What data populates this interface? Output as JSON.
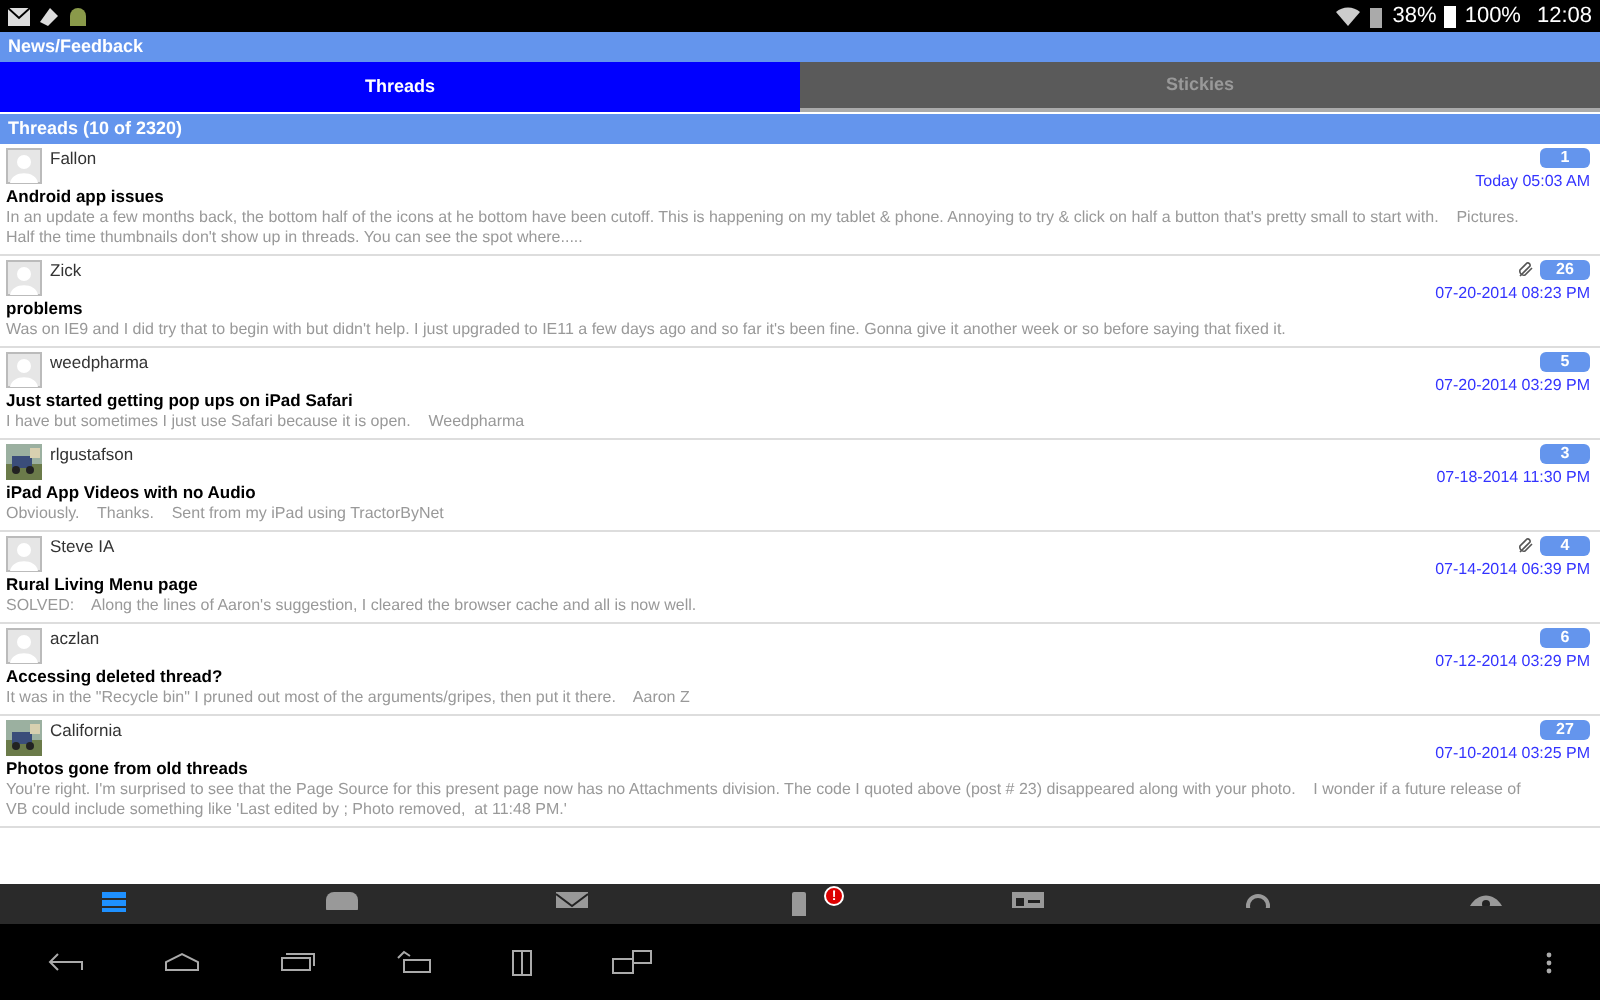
{
  "status_bar": {
    "signal_text": "38%",
    "battery": "100%",
    "time": "12:08"
  },
  "title": "News/Feedback",
  "tabs": [
    {
      "label": "Threads",
      "selected": true
    },
    {
      "label": "Stickies",
      "selected": false
    }
  ],
  "section_header": "Threads (10 of 2320)",
  "threads": [
    {
      "author": "Fallon",
      "kind": "default",
      "title": "Android app issues",
      "preview": "In an update a few months back, the bottom half of the icons at he bottom have been cutoff. This is happening on my tablet & phone. Annoying to try & click on half a button that's pretty small to start with.    Pictures. Half the time thumbnails don't show up in threads. You can see the spot where.....",
      "count": "1",
      "date": "Today 05:03 AM",
      "attachment": false
    },
    {
      "author": "Zick",
      "kind": "default",
      "title": "problems",
      "preview": "Was on IE9 and I did try that to begin with but didn't help. I just upgraded to IE11 a few days ago and so far it's been fine. Gonna give it another week or so before saying that fixed it.",
      "count": "26",
      "date": "07-20-2014 08:23 PM",
      "attachment": true
    },
    {
      "author": "weedpharma",
      "kind": "default",
      "title": "Just started getting pop ups on iPad Safari",
      "preview": "I have but sometimes I just use Safari because it is open.    Weedpharma",
      "count": "5",
      "date": "07-20-2014 03:29 PM",
      "attachment": false
    },
    {
      "author": "rlgustafson",
      "kind": "picture",
      "title": "iPad App Videos with no Audio",
      "preview": "Obviously.    Thanks.    Sent from my iPad using TractorByNet",
      "count": "3",
      "date": "07-18-2014 11:30 PM",
      "attachment": false
    },
    {
      "author": "Steve IA",
      "kind": "default",
      "title": "Rural Living Menu page",
      "preview": "SOLVED:    Along the lines of Aaron's suggestion, I cleared the browser cache and all is now well.",
      "count": "4",
      "date": "07-14-2014 06:39 PM",
      "attachment": true
    },
    {
      "author": "aczlan",
      "kind": "default",
      "title": "Accessing deleted thread?",
      "preview": "It was in the \"Recycle bin\" I pruned out most of the arguments/gripes, then put it there.    Aaron Z",
      "count": "6",
      "date": "07-12-2014 03:29 PM",
      "attachment": false
    },
    {
      "author": "California",
      "kind": "picture",
      "title": "Photos gone from old threads",
      "preview": "You're right. I'm surprised to see that the Page Source for this present page now has no Attachments division. The code I quoted above (post # 23) disappeared along with your photo.    I wonder if a future release of VB could include something like 'Last edited by ; Photo removed,  at 11:48 PM.'",
      "count": "27",
      "date": "07-10-2014 03:25 PM",
      "attachment": false
    }
  ],
  "bottom_tabs": [
    {
      "kind": "list",
      "selected": true
    },
    {
      "kind": "chat",
      "selected": false
    },
    {
      "kind": "mail",
      "selected": false
    },
    {
      "kind": "phone",
      "selected": false,
      "badge": "!"
    },
    {
      "kind": "card",
      "selected": false
    },
    {
      "kind": "search",
      "selected": false
    },
    {
      "kind": "eye",
      "selected": false
    }
  ]
}
